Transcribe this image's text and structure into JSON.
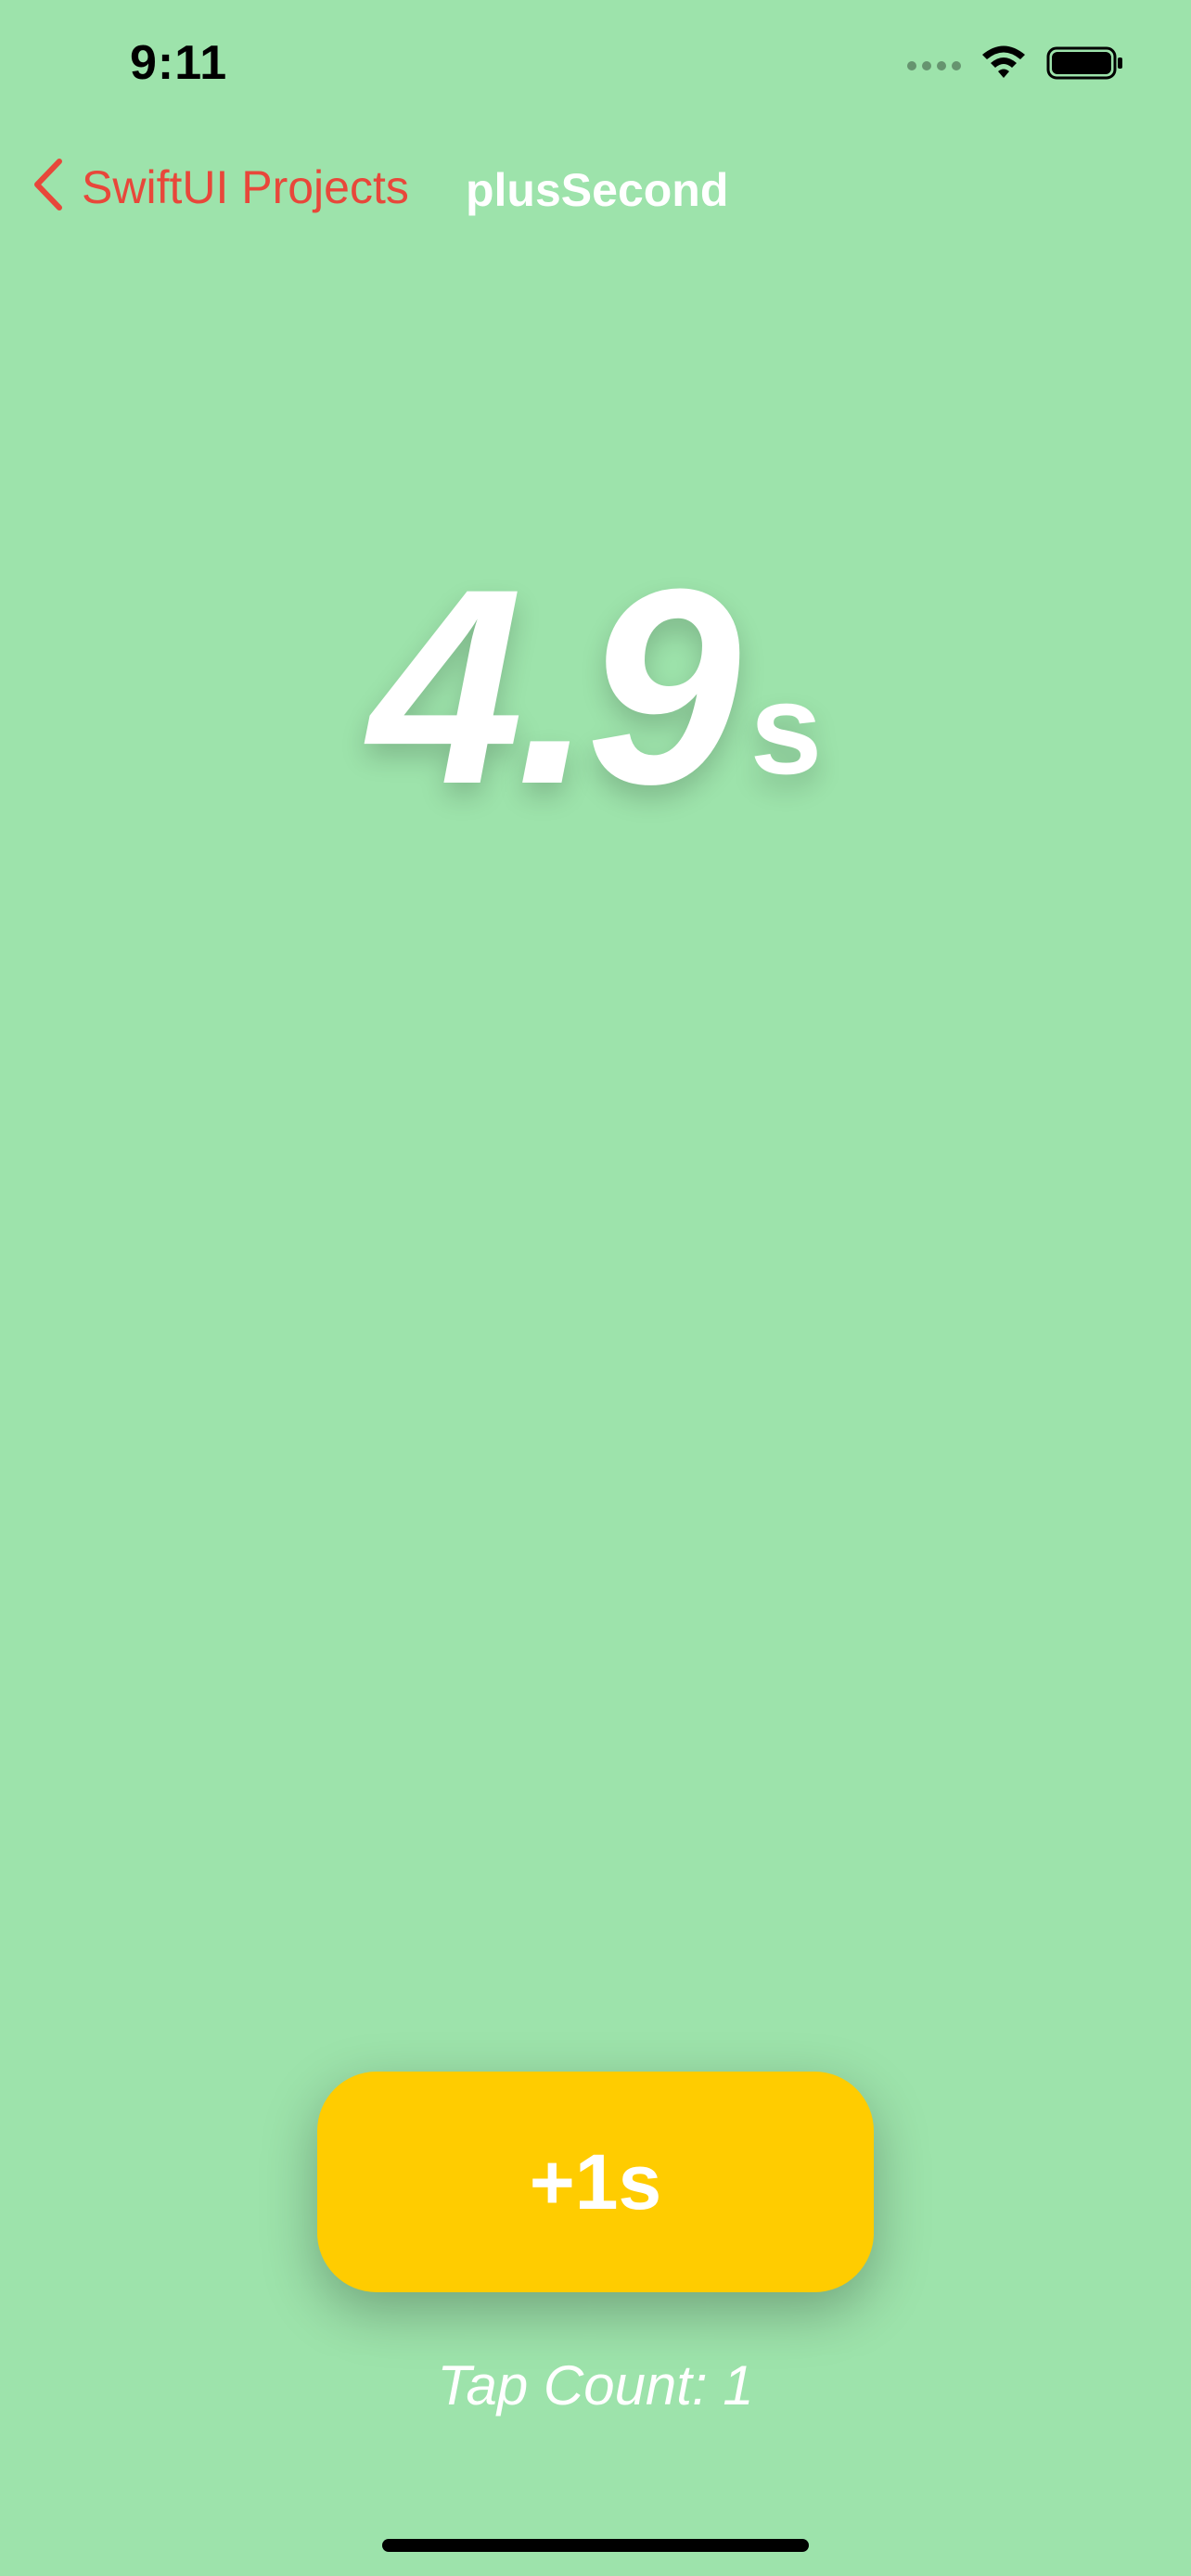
{
  "status_bar": {
    "time": "9:11",
    "icons": [
      "signal-dots-icon",
      "wifi-icon",
      "battery-icon"
    ]
  },
  "nav": {
    "back_label": "SwiftUI Projects",
    "title": "plusSecond",
    "back_icon": "chevron-left-icon"
  },
  "timer": {
    "value": "4.9",
    "unit": "s"
  },
  "action": {
    "button_label": "+1s"
  },
  "footer": {
    "tap_count": "Tap Count: 1"
  },
  "colors": {
    "background": "#9de3ab",
    "accent": "#e8473a",
    "button": "#ffcc00",
    "text": "#ffffff"
  }
}
